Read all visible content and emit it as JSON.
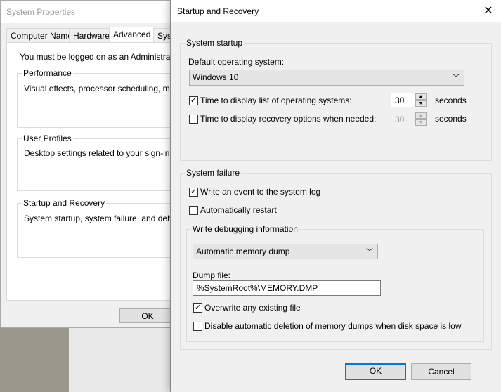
{
  "system_properties": {
    "title": "System Properties",
    "tabs": [
      "Computer Name",
      "Hardware",
      "Advanced",
      "Syst"
    ],
    "admin_note": "You must be logged on as an Administrator to",
    "groups": [
      {
        "title": "Performance",
        "desc": "Visual effects, processor scheduling, memory"
      },
      {
        "title": "User Profiles",
        "desc": "Desktop settings related to your sign-in"
      },
      {
        "title": "Startup and Recovery",
        "desc": "System startup, system failure, and debuggin"
      }
    ],
    "ok": "OK"
  },
  "dialog": {
    "title": "Startup and Recovery",
    "close_icon": "close-icon",
    "startup": {
      "title": "System startup",
      "default_os_label": "Default operating system:",
      "default_os": "Windows 10",
      "list_label": "Time to display list of operating systems:",
      "list_checked": true,
      "list_value": "30",
      "recovery_label": "Time to display recovery options when needed:",
      "recovery_checked": false,
      "recovery_value": "30",
      "unit": "seconds"
    },
    "failure": {
      "title": "System failure",
      "write_event": "Write an event to the system log",
      "write_event_checked": true,
      "auto_restart": "Automatically restart",
      "auto_restart_checked": false,
      "debug": {
        "title": "Write debugging information",
        "dump_type": "Automatic memory dump",
        "dump_file_label": "Dump file:",
        "dump_file": "%SystemRoot%\\MEMORY.DMP",
        "overwrite": "Overwrite any existing file",
        "overwrite_checked": true,
        "disable_delete": "Disable automatic deletion of memory dumps when disk space is low",
        "disable_delete_checked": false
      }
    },
    "ok": "OK",
    "cancel": "Cancel"
  }
}
